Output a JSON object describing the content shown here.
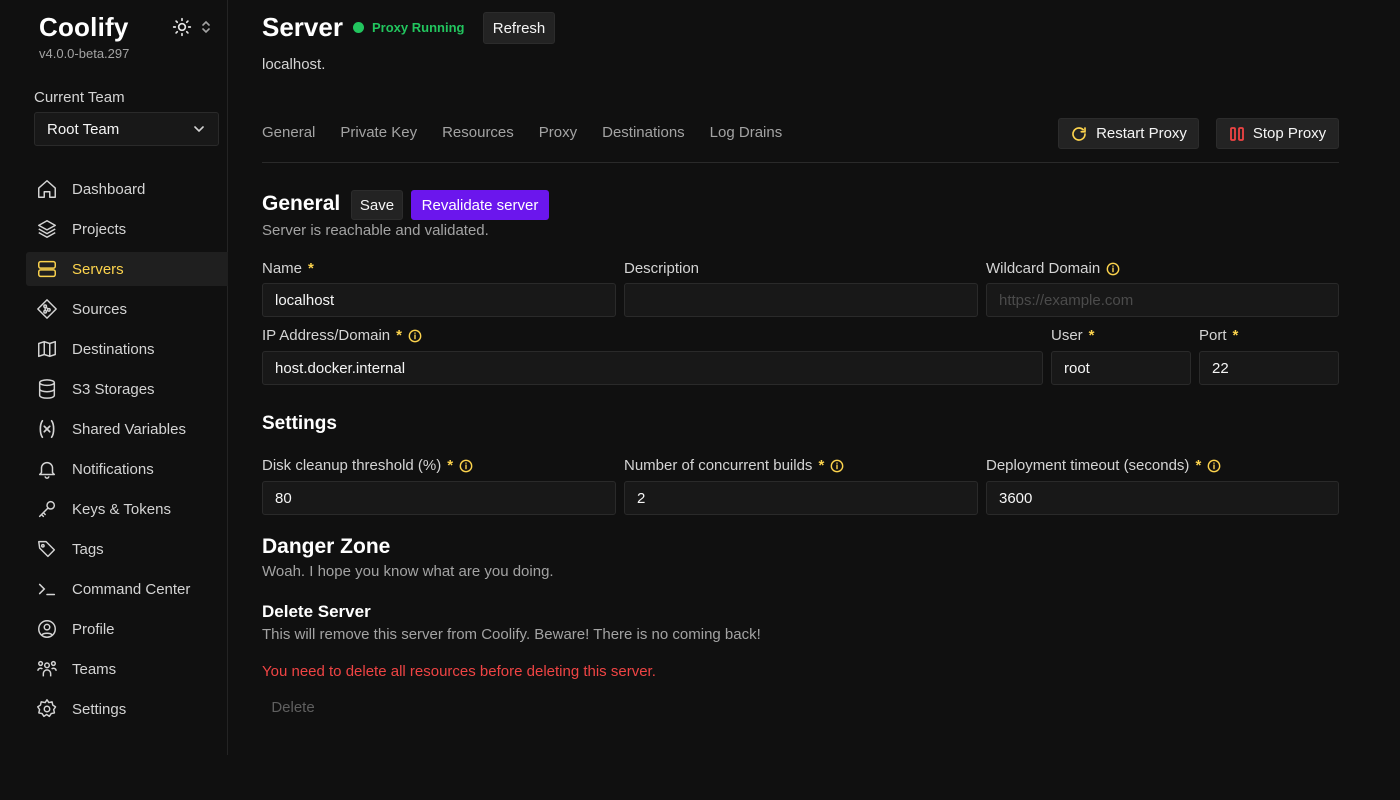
{
  "app": {
    "name": "Coolify",
    "version": "v4.0.0-beta.297"
  },
  "team": {
    "label": "Current Team",
    "selected": "Root Team"
  },
  "nav": [
    {
      "label": "Dashboard",
      "icon": "home-icon"
    },
    {
      "label": "Projects",
      "icon": "layers-icon"
    },
    {
      "label": "Servers",
      "icon": "server-icon",
      "active": true
    },
    {
      "label": "Sources",
      "icon": "git-icon"
    },
    {
      "label": "Destinations",
      "icon": "map-icon"
    },
    {
      "label": "S3 Storages",
      "icon": "database-icon"
    },
    {
      "label": "Shared Variables",
      "icon": "variable-icon"
    },
    {
      "label": "Notifications",
      "icon": "bell-icon"
    },
    {
      "label": "Keys & Tokens",
      "icon": "key-icon"
    },
    {
      "label": "Tags",
      "icon": "tag-icon"
    },
    {
      "label": "Command Center",
      "icon": "terminal-icon"
    },
    {
      "label": "Profile",
      "icon": "user-icon"
    },
    {
      "label": "Teams",
      "icon": "users-icon"
    },
    {
      "label": "Settings",
      "icon": "gear-icon"
    }
  ],
  "header": {
    "title": "Server",
    "status": "Proxy Running",
    "refresh_label": "Refresh",
    "subtitle": "localhost."
  },
  "tabs": [
    "General",
    "Private Key",
    "Resources",
    "Proxy",
    "Destinations",
    "Log Drains"
  ],
  "proxy_actions": {
    "restart_label": "Restart Proxy",
    "stop_label": "Stop Proxy"
  },
  "general": {
    "title": "General",
    "save_label": "Save",
    "revalidate_label": "Revalidate server",
    "status_text": "Server is reachable and validated.",
    "name": {
      "label": "Name",
      "value": "localhost"
    },
    "description": {
      "label": "Description",
      "value": ""
    },
    "wildcard": {
      "label": "Wildcard Domain",
      "placeholder": "https://example.com"
    },
    "ip": {
      "label": "IP Address/Domain",
      "value": "host.docker.internal"
    },
    "user": {
      "label": "User",
      "value": "root"
    },
    "port": {
      "label": "Port",
      "value": "22"
    }
  },
  "settings": {
    "title": "Settings",
    "disk": {
      "label": "Disk cleanup threshold (%)",
      "value": "80"
    },
    "builds": {
      "label": "Number of concurrent builds",
      "value": "2"
    },
    "timeout": {
      "label": "Deployment timeout (seconds)",
      "value": "3600"
    }
  },
  "danger": {
    "title": "Danger Zone",
    "subtitle": "Woah. I hope you know what are you doing.",
    "delete_title": "Delete Server",
    "delete_desc": "This will remove this server from Coolify. Beware! There is no coming back!",
    "warning": "You need to delete all resources before deleting this server.",
    "delete_label": "Delete"
  },
  "colors": {
    "accent": "#fcd34d",
    "primary": "#6b16ed",
    "success": "#22c55e",
    "danger": "#ef4444",
    "background": "#101010"
  }
}
